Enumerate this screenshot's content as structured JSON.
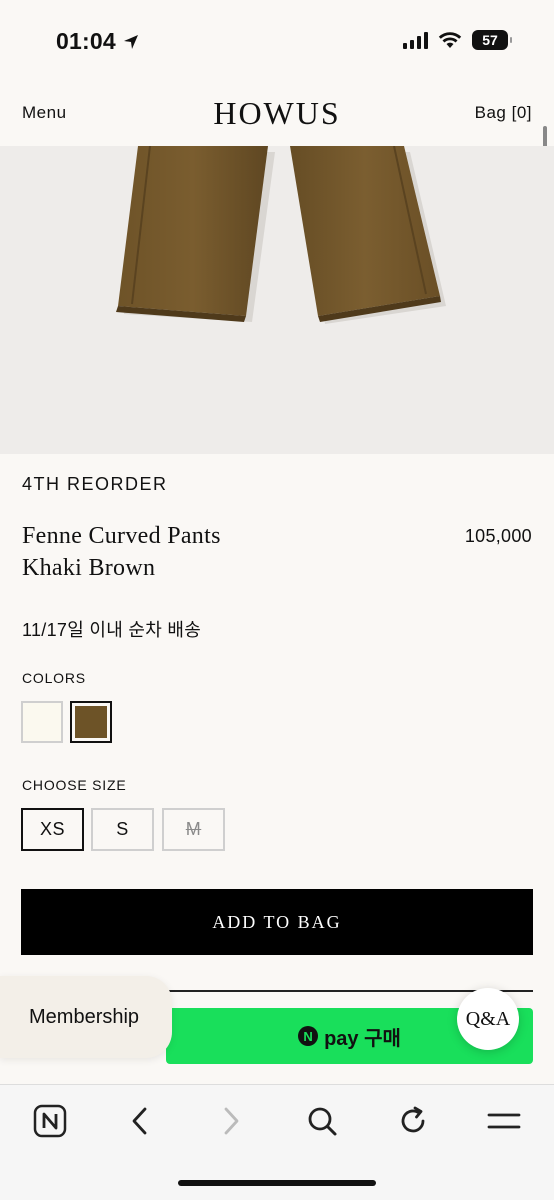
{
  "status_bar": {
    "time": "01:04",
    "battery": "57"
  },
  "header": {
    "menu_label": "Menu",
    "brand": "HOWUS",
    "bag_label": "Bag [0]"
  },
  "product": {
    "tag": "4TH REORDER",
    "name_line1": "Fenne Curved Pants",
    "name_line2": "Khaki Brown",
    "price": "105,000",
    "shipping_note": "11/17일 이내 순차 배송"
  },
  "colors": {
    "label": "COLORS",
    "options": [
      {
        "name": "cream",
        "hex": "#fbf9ef",
        "selected": false
      },
      {
        "name": "khaki-brown",
        "hex": "#6d5327",
        "selected": true
      }
    ]
  },
  "sizes": {
    "label": "CHOOSE SIZE",
    "options": [
      {
        "label": "XS",
        "selected": true,
        "available": true
      },
      {
        "label": "S",
        "selected": false,
        "available": true
      },
      {
        "label": "M",
        "selected": false,
        "available": false
      }
    ]
  },
  "actions": {
    "add_to_bag": "ADD TO BAG",
    "npay_logo": "N",
    "npay_label": "pay 구매",
    "membership": "Membership",
    "qa": "Q&A"
  },
  "colors_theme": {
    "npay_green": "#19df5b",
    "button_black": "#000000"
  },
  "toolbar_icons": [
    "naver-icon",
    "back-icon",
    "forward-icon",
    "search-icon",
    "refresh-icon",
    "menu-icon"
  ]
}
